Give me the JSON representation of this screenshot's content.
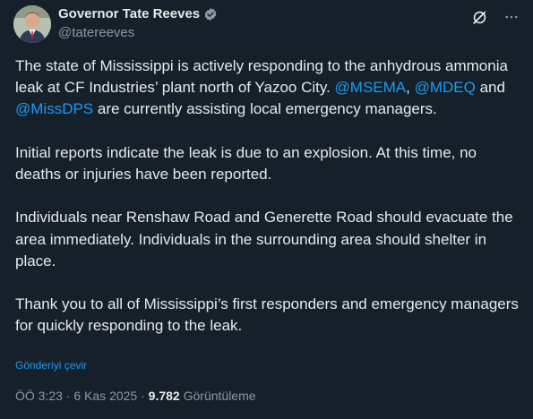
{
  "author": {
    "name": "Governor Tate Reeves",
    "handle": "@tatereeves",
    "verified_color": "#8b98a5"
  },
  "icons": [
    "verified-badge-icon",
    "grok-icon",
    "more-options-icon"
  ],
  "tweet": {
    "p1_a": "The state of Mississippi is actively responding to the anhydrous ammonia leak at CF Industries’ plant north of Yazoo City. ",
    "p1_m1": "@MSEMA",
    "p1_b": ", ",
    "p1_m2": "@MDEQ",
    "p1_c": " and ",
    "p1_m3": "@MissDPS",
    "p1_d": " are currently assisting local emergency managers.",
    "p2": "Initial reports indicate the leak is due to an explosion. At this time, no deaths or injuries have been reported.",
    "p3": "Individuals near Renshaw Road and Generette Road should evacuate the area immediately. Individuals in the surrounding area should shelter in place.",
    "p4": "Thank you to all of Mississippi’s first responders and emergency managers for quickly responding to the leak."
  },
  "translate_label": "Gönderiyi çevir",
  "meta": {
    "time": "ÖÖ 3:23",
    "sep": " · ",
    "date": "6 Kas 2025",
    "sep2": " · ",
    "views": "9.782",
    "views_label": " Görüntüleme"
  },
  "colors": {
    "background": "#15202b",
    "text": "#e7e9ea",
    "secondary": "#8b98a5",
    "link": "#1d9bf0"
  }
}
